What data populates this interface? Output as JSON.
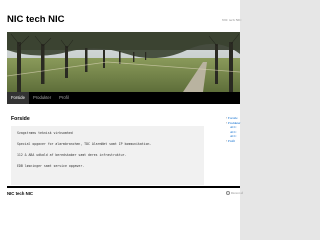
{
  "site": {
    "title": "NIC tech NIC",
    "description": "NIC tech NIC"
  },
  "nav": {
    "items": [
      {
        "label": "Forside",
        "active": true
      },
      {
        "label": "Produkter",
        "active": false
      },
      {
        "label": "Profil",
        "active": false
      }
    ]
  },
  "entry": {
    "title": "Forside",
    "lines": [
      "Svagstrøms teknisk virksomhed",
      "Special opgaver for alarmbranchen, TDC AlarmNet samt IP kommunikation.",
      "112 & ABA udkald af beredskaber samt deres infrastruktur.",
      "EDB løsninger samt service opgaver."
    ]
  },
  "sidebar": {
    "items": [
      {
        "label": "Forside",
        "sub": false
      },
      {
        "label": "Produkter",
        "sub": false
      },
      {
        "label": "ACC",
        "sub": true
      },
      {
        "label": "ACC",
        "sub": true
      },
      {
        "label": "ACC",
        "sub": true
      },
      {
        "label": "Profil",
        "sub": false
      }
    ]
  },
  "footer": {
    "title": "NIC tech NIC",
    "credit": "Drevet af"
  },
  "colors": {
    "nav_bg": "#000000",
    "link": "#0066cc",
    "content_bg": "#f1f1f1"
  }
}
